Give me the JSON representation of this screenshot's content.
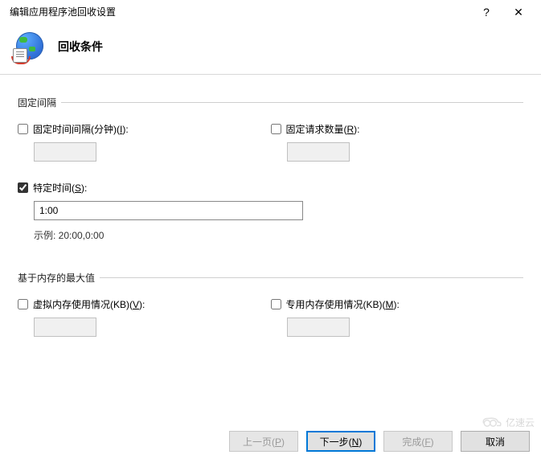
{
  "titlebar": {
    "title": "编辑应用程序池回收设置",
    "help": "?",
    "close": "✕"
  },
  "header": {
    "title": "回收条件"
  },
  "group_fixed": {
    "legend": "固定间隔",
    "interval": {
      "label_pre": "固定时间间隔(分钟)(",
      "hotkey": "I",
      "label_post": "):",
      "value": ""
    },
    "requests": {
      "label_pre": "固定请求数量(",
      "hotkey": "R",
      "label_post": "):",
      "value": ""
    },
    "time": {
      "label_pre": "特定时间(",
      "hotkey": "S",
      "label_post": "):",
      "value": "1:00"
    },
    "example": "示例: 20:00,0:00"
  },
  "group_mem": {
    "legend": "基于内存的最大值",
    "virtual": {
      "label_pre": "虚拟内存使用情况(KB)(",
      "hotkey": "V",
      "label_post": "):",
      "value": ""
    },
    "private": {
      "label_pre": "专用内存使用情况(KB)(",
      "hotkey": "M",
      "label_post": "):",
      "value": ""
    }
  },
  "buttons": {
    "prev_pre": "上一页(",
    "prev_hotkey": "P",
    "prev_post": ")",
    "next_pre": "下一步(",
    "next_hotkey": "N",
    "next_post": ")",
    "finish_pre": "完成(",
    "finish_hotkey": "F",
    "finish_post": ")",
    "cancel": "取消"
  },
  "watermark": "亿速云"
}
